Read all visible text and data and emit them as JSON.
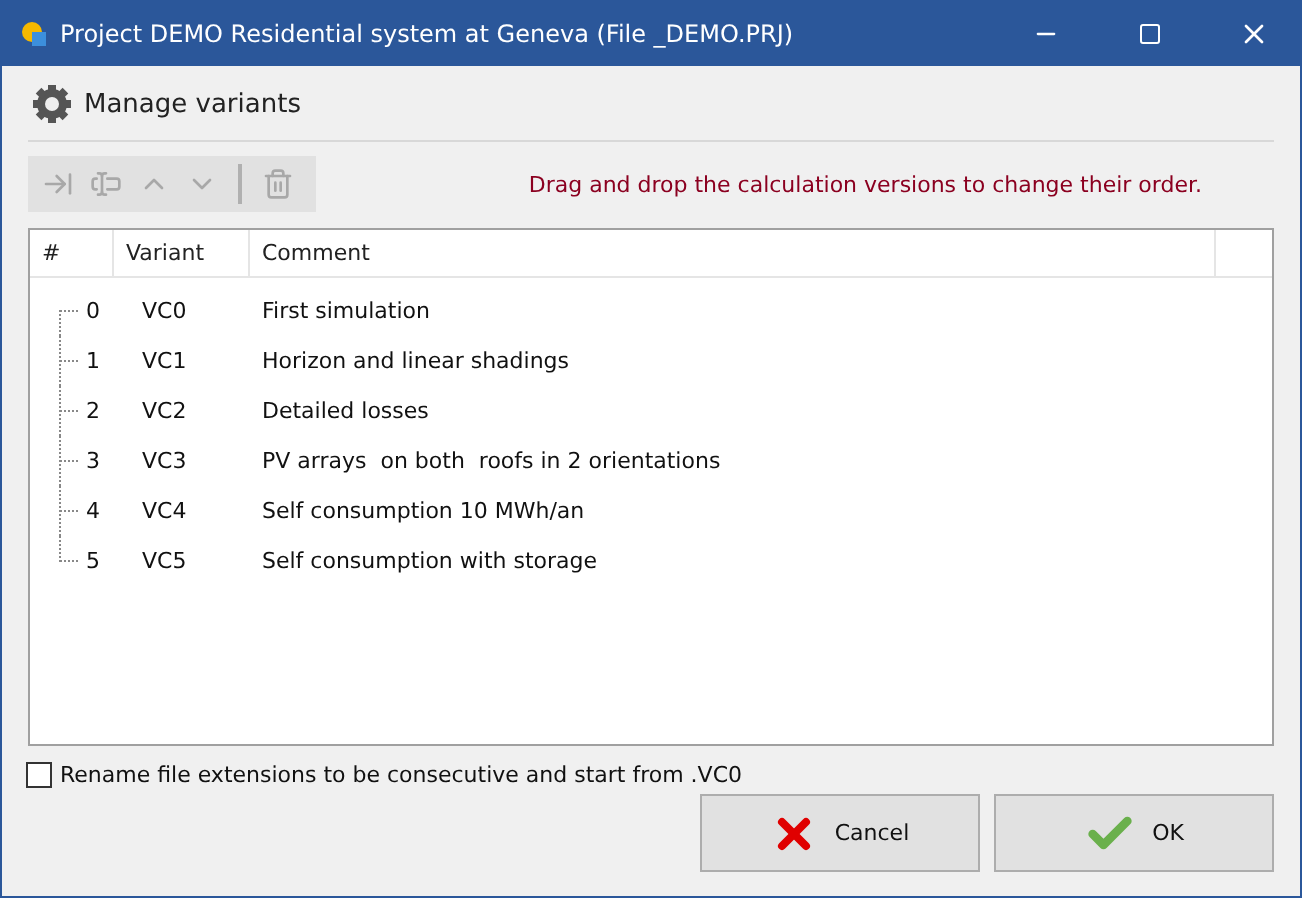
{
  "window": {
    "title": "Project DEMO Residential system at Geneva (File _DEMO.PRJ)"
  },
  "header": {
    "title": "Manage variants"
  },
  "toolbar": [
    {
      "kind": "import",
      "disabled": true
    },
    {
      "kind": "rename",
      "disabled": true
    },
    {
      "kind": "up",
      "disabled": true
    },
    {
      "kind": "down",
      "disabled": true
    },
    {
      "kind": "separator"
    },
    {
      "kind": "delete",
      "disabled": true
    }
  ],
  "hint": "Drag and drop the calculation versions to change their order.",
  "table": {
    "columns": [
      "#",
      "Variant",
      "Comment"
    ],
    "rows": [
      {
        "number": "0",
        "variant": "VC0",
        "comment": "First simulation"
      },
      {
        "number": "1",
        "variant": "VC1",
        "comment": "Horizon and linear shadings"
      },
      {
        "number": "2",
        "variant": "VC2",
        "comment": "Detailed losses"
      },
      {
        "number": "3",
        "variant": "VC3",
        "comment": "PV arrays  on both  roofs in 2 orientations"
      },
      {
        "number": "4",
        "variant": "VC4",
        "comment": "Self consumption 10 MWh/an"
      },
      {
        "number": "5",
        "variant": "VC5",
        "comment": "Self consumption with storage"
      }
    ]
  },
  "rename_option": {
    "label": "Rename file extensions to be consecutive and start from .VC0",
    "checked": false
  },
  "buttons": [
    {
      "kind": "cancel",
      "label": "Cancel"
    },
    {
      "kind": "ok",
      "label": "OK"
    }
  ]
}
